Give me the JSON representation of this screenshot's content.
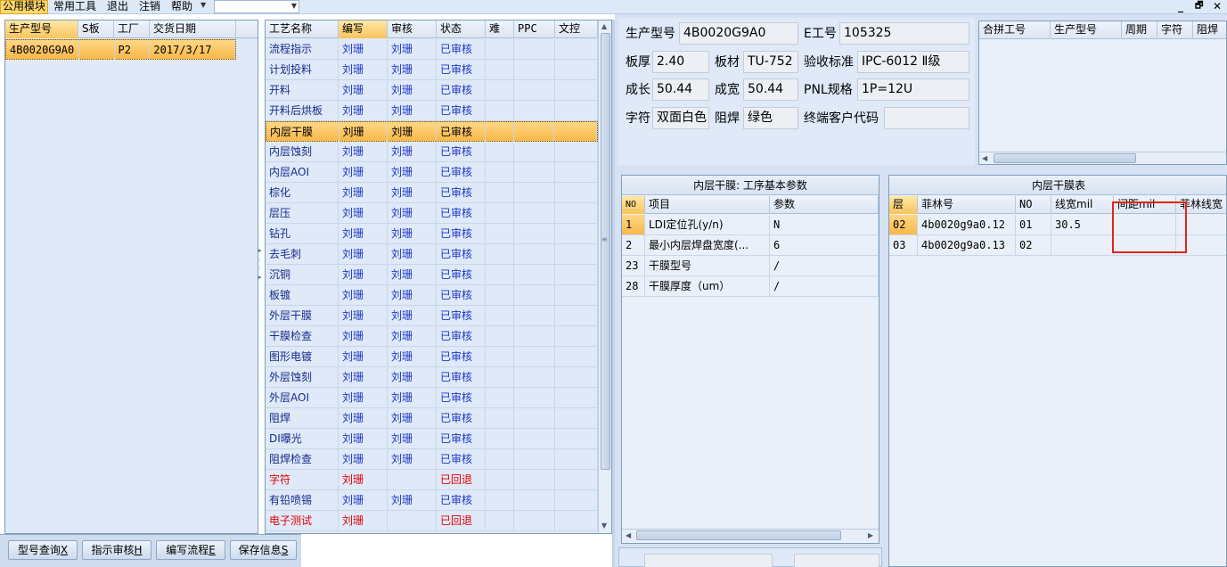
{
  "menu": {
    "items": [
      "公用模块",
      "常用工具",
      "退出",
      "注销",
      "帮助"
    ],
    "window_controls": [
      "_",
      "🗗",
      "✕"
    ]
  },
  "left_grid": {
    "columns": [
      "生产型号",
      "S板",
      "工厂",
      "交货日期"
    ],
    "rows": [
      [
        "4B0020G9A0",
        "",
        "P2",
        "2017/3/17"
      ]
    ]
  },
  "process_grid": {
    "columns": [
      "工艺名称",
      "编写",
      "审核",
      "状态",
      "难",
      "PPC",
      "文控"
    ],
    "rows": [
      {
        "name": "流程指示",
        "writer": "刘珊",
        "reviewer": "刘珊",
        "status": "已审核",
        "returned": false
      },
      {
        "name": "计划投料",
        "writer": "刘珊",
        "reviewer": "刘珊",
        "status": "已审核",
        "returned": false
      },
      {
        "name": "开料",
        "writer": "刘珊",
        "reviewer": "刘珊",
        "status": "已审核",
        "returned": false
      },
      {
        "name": "开料后烘板",
        "writer": "刘珊",
        "reviewer": "刘珊",
        "status": "已审核",
        "returned": false
      },
      {
        "name": "内层干膜",
        "writer": "刘珊",
        "reviewer": "刘珊",
        "status": "已审核",
        "returned": false
      },
      {
        "name": "内层蚀刻",
        "writer": "刘珊",
        "reviewer": "刘珊",
        "status": "已审核",
        "returned": false
      },
      {
        "name": "内层AOI",
        "writer": "刘珊",
        "reviewer": "刘珊",
        "status": "已审核",
        "returned": false
      },
      {
        "name": "棕化",
        "writer": "刘珊",
        "reviewer": "刘珊",
        "status": "已审核",
        "returned": false
      },
      {
        "name": "层压",
        "writer": "刘珊",
        "reviewer": "刘珊",
        "status": "已审核",
        "returned": false
      },
      {
        "name": "钻孔",
        "writer": "刘珊",
        "reviewer": "刘珊",
        "status": "已审核",
        "returned": false
      },
      {
        "name": "去毛刺",
        "writer": "刘珊",
        "reviewer": "刘珊",
        "status": "已审核",
        "returned": false
      },
      {
        "name": "沉铜",
        "writer": "刘珊",
        "reviewer": "刘珊",
        "status": "已审核",
        "returned": false
      },
      {
        "name": "板镀",
        "writer": "刘珊",
        "reviewer": "刘珊",
        "status": "已审核",
        "returned": false
      },
      {
        "name": "外层干膜",
        "writer": "刘珊",
        "reviewer": "刘珊",
        "status": "已审核",
        "returned": false
      },
      {
        "name": "干膜检查",
        "writer": "刘珊",
        "reviewer": "刘珊",
        "status": "已审核",
        "returned": false
      },
      {
        "name": "图形电镀",
        "writer": "刘珊",
        "reviewer": "刘珊",
        "status": "已审核",
        "returned": false
      },
      {
        "name": "外层蚀刻",
        "writer": "刘珊",
        "reviewer": "刘珊",
        "status": "已审核",
        "returned": false
      },
      {
        "name": "外层AOI",
        "writer": "刘珊",
        "reviewer": "刘珊",
        "status": "已审核",
        "returned": false
      },
      {
        "name": "阻焊",
        "writer": "刘珊",
        "reviewer": "刘珊",
        "status": "已审核",
        "returned": false
      },
      {
        "name": "DI曝光",
        "writer": "刘珊",
        "reviewer": "刘珊",
        "status": "已审核",
        "returned": false
      },
      {
        "name": "阻焊检查",
        "writer": "刘珊",
        "reviewer": "刘珊",
        "status": "已审核",
        "returned": false
      },
      {
        "name": "字符",
        "writer": "刘珊",
        "reviewer": "",
        "status": "已回退",
        "returned": true
      },
      {
        "name": "有铅喷锡",
        "writer": "刘珊",
        "reviewer": "刘珊",
        "status": "已审核",
        "returned": false
      },
      {
        "name": "电子测试",
        "writer": "刘珊",
        "reviewer": "",
        "status": "已回退",
        "returned": true
      }
    ]
  },
  "info": {
    "model_label": "生产型号",
    "model_value": "4B0020G9A0",
    "e_label": "E工号",
    "e_value": "105325",
    "thick_label": "板厚",
    "thick_value": "2.40",
    "material_label": "板材",
    "material_value": "TU-752",
    "std_label": "验收标准",
    "std_value": "IPC-6012 Ⅱ级",
    "len_label": "成长",
    "len_value": "50.44",
    "width_label": "成宽",
    "width_value": "50.44",
    "pnl_label": "PNL规格",
    "pnl_value": "1P=12U",
    "char_label": "字符",
    "char_value": "双面白色",
    "solder_label": "阻焊",
    "solder_value": "绿色",
    "customer_label": "终端客户代码",
    "customer_value": ""
  },
  "merge_grid": {
    "columns": [
      "合拼工号",
      "生产型号",
      "周期",
      "字符",
      "阻焊"
    ]
  },
  "params_grid": {
    "title": "内层干膜: 工序基本参数",
    "columns": [
      "NO",
      "项目",
      "参数"
    ],
    "rows": [
      [
        "1",
        "LDI定位孔(y/n)",
        "N"
      ],
      [
        "2",
        "最小内层焊盘宽度(...",
        "6"
      ],
      [
        "23",
        "干膜型号",
        "/"
      ],
      [
        "28",
        "干膜厚度（um）",
        "/"
      ]
    ]
  },
  "film_grid": {
    "title": "内层干膜表",
    "columns": [
      "层",
      "菲林号",
      "NO",
      "线宽mil",
      "间距mil",
      "菲林线宽"
    ],
    "rows": [
      [
        "02",
        "4b0020g9a0.12",
        "01",
        "30.5",
        "",
        ""
      ],
      [
        "03",
        "4b0020g9a0.13",
        "02",
        "",
        "",
        ""
      ]
    ]
  },
  "buttons": [
    {
      "label": "型号查询",
      "key": "X"
    },
    {
      "label": "指示审核",
      "key": "H"
    },
    {
      "label": "编写流程",
      "key": "E"
    },
    {
      "label": "保存信息",
      "key": "S"
    }
  ]
}
